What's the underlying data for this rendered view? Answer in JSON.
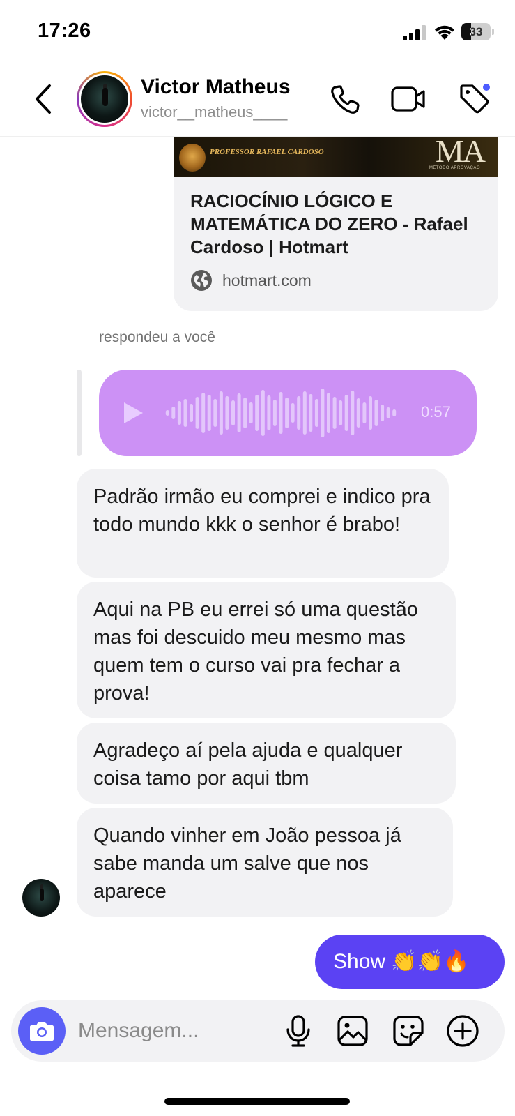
{
  "status_bar": {
    "time": "17:26",
    "battery": "33",
    "battery_level_percent": 33
  },
  "header": {
    "name": "Victor Matheus",
    "handle": "victor__matheus____",
    "icons": [
      "back-icon",
      "phone-icon",
      "video-camera-icon",
      "tag-icon"
    ]
  },
  "link_preview": {
    "banner_text": "PROFESSOR RAFAEL CARDOSO",
    "banner_logo": "MA",
    "banner_sub": "MÉTODO APROVAÇÃO",
    "title": "RACIOCÍNIO LÓGICO E MATEMÁTICA DO ZERO - Rafael Cardoso | Hotmart",
    "domain": "hotmart.com"
  },
  "reply": {
    "label": "respondeu a você",
    "audio_duration": "0:57"
  },
  "messages": [
    {
      "text": "Padrão irmão eu comprei e indico pra todo mundo kkk o senhor é brabo!"
    },
    {
      "text": "Aqui na PB eu errei só uma questão mas foi descuido meu mesmo mas quem tem o curso vai pra fechar a prova!"
    },
    {
      "text": "Agradeço aí pela ajuda e qualquer coisa tamo por aqui tbm"
    },
    {
      "text": "Quando vinher em João pessoa já sabe manda um salve que nos aparece"
    }
  ],
  "outgoing": {
    "text": "Show 👏👏🔥"
  },
  "composer": {
    "placeholder": "Mensagem...",
    "icons": [
      "camera-icon",
      "microphone-icon",
      "gallery-icon",
      "sticker-icon",
      "plus-icon"
    ]
  },
  "colors": {
    "accent": "#5b42f3",
    "audio_bubble": "#cc91f5",
    "incoming_bubble": "#f2f2f4",
    "tag_dot": "#4d5cff"
  }
}
